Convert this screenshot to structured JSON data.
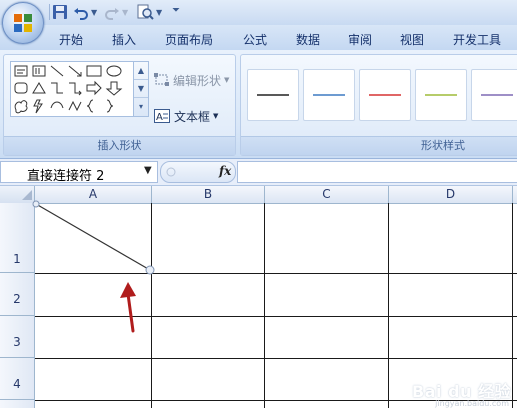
{
  "ribbon_tabs": [
    "开始",
    "插入",
    "页面布局",
    "公式",
    "数据",
    "审阅",
    "视图",
    "开发工具"
  ],
  "ribbon": {
    "insert_shapes_group": {
      "label": "插入形状"
    },
    "edit_shape_label": "编辑形状",
    "textbox_label": "文本框",
    "shape_styles_group": {
      "label": "形状样式"
    },
    "style_colors": [
      "#595959",
      "#6d9bd1",
      "#e06666",
      "#b6cc6a",
      "#9e8fc7"
    ]
  },
  "formula_bar": {
    "name_box": "直接连接符 2",
    "fx_label": "fx",
    "formula_value": ""
  },
  "sheet": {
    "columns": [
      "A",
      "B",
      "C",
      "D"
    ],
    "rows": [
      "1",
      "2",
      "3",
      "4"
    ]
  },
  "colors": {
    "arrow": "#b01c1c",
    "connector": "#333333",
    "grid": "#1a1a1a"
  },
  "watermark": {
    "text": "Bai du 经验",
    "sub": "jingyan.baidu.com"
  }
}
